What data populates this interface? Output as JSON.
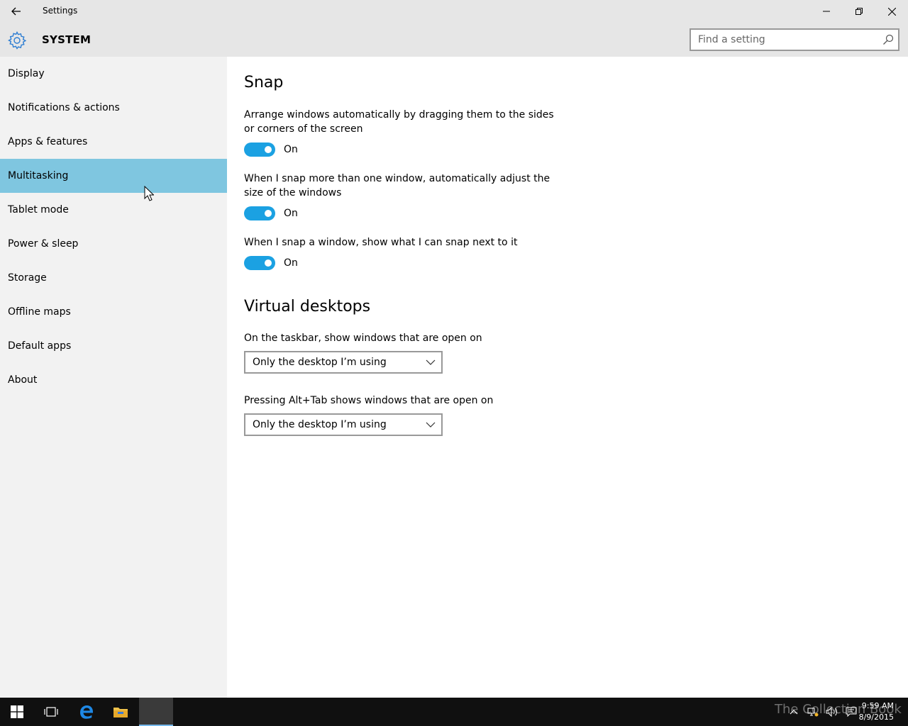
{
  "window": {
    "title": "Settings"
  },
  "header": {
    "section_title": "SYSTEM",
    "search_placeholder": "Find a setting"
  },
  "sidebar": {
    "items": [
      {
        "label": "Display"
      },
      {
        "label": "Notifications & actions"
      },
      {
        "label": "Apps & features"
      },
      {
        "label": "Multitasking",
        "selected": true
      },
      {
        "label": "Tablet mode"
      },
      {
        "label": "Power & sleep"
      },
      {
        "label": "Storage"
      },
      {
        "label": "Offline maps"
      },
      {
        "label": "Default apps"
      },
      {
        "label": "About"
      }
    ]
  },
  "snap": {
    "heading": "Snap",
    "settings": [
      {
        "description": "Arrange windows automatically by dragging them to the sides or corners of the screen",
        "state": "On"
      },
      {
        "description": "When I snap more than one window, automatically adjust the size of the windows",
        "state": "On"
      },
      {
        "description": "When I snap a window, show what I can snap next to it",
        "state": "On"
      }
    ]
  },
  "virtual_desktops": {
    "heading": "Virtual desktops",
    "taskbar_label": "On the taskbar, show windows that are open on",
    "taskbar_value": "Only the desktop I’m using",
    "alttab_label": "Pressing Alt+Tab shows windows that are open on",
    "alttab_value": "Only the desktop I’m using"
  },
  "taskbar": {
    "time": "9:59 AM",
    "date": "8/9/2015",
    "watermark": "The Collection Book"
  },
  "colors": {
    "accent": "#1ba1e2",
    "selected_nav": "#7fc6e0",
    "gear": "#2d7dd2"
  }
}
